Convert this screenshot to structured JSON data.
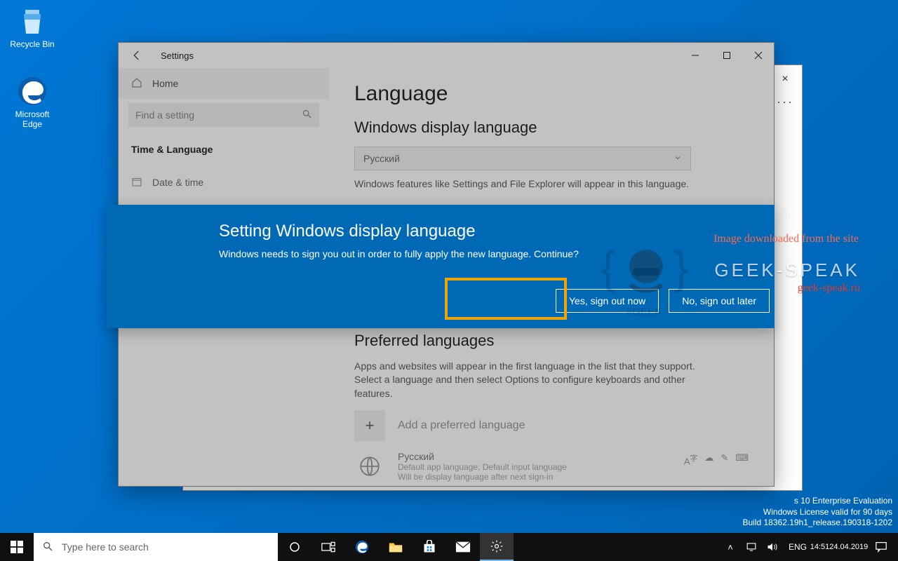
{
  "desktop": {
    "icons": {
      "recycle_bin": "Recycle Bin",
      "edge": "Microsoft Edge"
    }
  },
  "behind_window": {
    "close": "×",
    "more": "···"
  },
  "settings": {
    "title": "Settings",
    "sidebar": {
      "home": "Home",
      "search_placeholder": "Find a setting",
      "category": "Time & Language",
      "items": [
        "Date & time"
      ]
    },
    "page": {
      "title": "Language",
      "display_section": "Windows display language",
      "display_selected": "Русский",
      "display_desc": "Windows features like Settings and File Explorer will appear in this language.",
      "preferred_section": "Preferred languages",
      "preferred_desc": "Apps and websites will appear in the first language in the list that they support. Select a language and then select Options to configure keyboards and other features.",
      "add_label": "Add a preferred language",
      "lang0": {
        "name": "Русский",
        "sub1": "Default app language; Default input language",
        "sub2": "Will be display language after next sign-in"
      }
    }
  },
  "modal": {
    "title": "Setting Windows display language",
    "message": "Windows needs to sign you out in order to fully apply the new language. Continue?",
    "yes": "Yes, sign out now",
    "no": "No, sign out later"
  },
  "watermark": {
    "line1": "Image downloaded from the site",
    "brand": "GEEK-SPEAK",
    "url": "geek-speak.ru",
    "hash": "#GEEK"
  },
  "build": {
    "l1": "s 10 Enterprise Evaluation",
    "l2": "Windows License valid for 90 days",
    "l3": "Build 18362.19h1_release.190318-1202"
  },
  "taskbar": {
    "search_placeholder": "Type here to search",
    "lang": "ENG",
    "time": "14:51",
    "date": "24.04.2019"
  }
}
